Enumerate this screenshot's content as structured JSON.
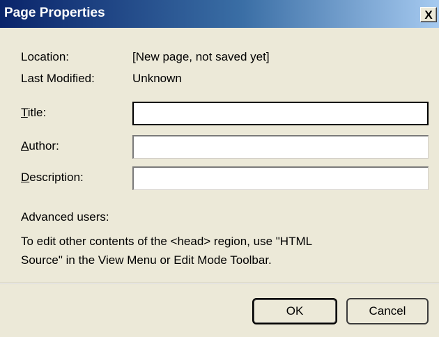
{
  "window": {
    "title": "Page Properties",
    "close_icon": "close-icon",
    "close_glyph": "X"
  },
  "info": {
    "location_label": "Location:",
    "location_value": "[New page, not saved yet]",
    "modified_label": "Last Modified:",
    "modified_value": "Unknown"
  },
  "fields": {
    "title": {
      "mnemonic": "T",
      "label_rest": "itle:",
      "value": ""
    },
    "author": {
      "mnemonic": "A",
      "label_rest": "uthor:",
      "value": ""
    },
    "description": {
      "mnemonic": "D",
      "label_rest": "escription:",
      "value": ""
    }
  },
  "advanced": {
    "heading": "Advanced users:",
    "line1": "To edit other contents of the <head> region, use \"HTML",
    "line2": "Source\" in the View Menu or Edit Mode Toolbar."
  },
  "buttons": {
    "ok": "OK",
    "cancel": "Cancel"
  }
}
